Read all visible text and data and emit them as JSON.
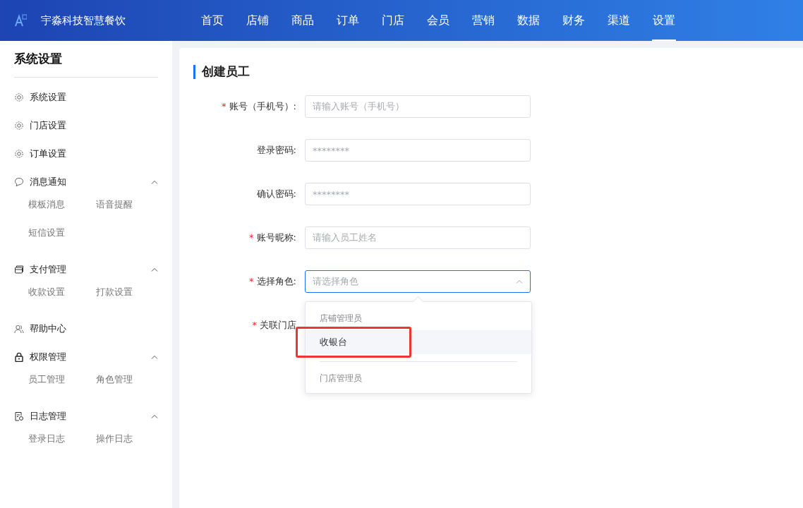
{
  "brand": {
    "name": "宇淼科技智慧餐饮"
  },
  "nav": [
    {
      "label": "首页",
      "selected": false
    },
    {
      "label": "店铺",
      "selected": false
    },
    {
      "label": "商品",
      "selected": false
    },
    {
      "label": "订单",
      "selected": false
    },
    {
      "label": "门店",
      "selected": false
    },
    {
      "label": "会员",
      "selected": false
    },
    {
      "label": "营销",
      "selected": false
    },
    {
      "label": "数据",
      "selected": false
    },
    {
      "label": "财务",
      "selected": false
    },
    {
      "label": "渠道",
      "selected": false
    },
    {
      "label": "设置",
      "selected": true
    }
  ],
  "sidebar": {
    "title": "系统设置",
    "items": [
      {
        "label": "系统设置"
      },
      {
        "label": "门店设置"
      },
      {
        "label": "订单设置"
      },
      {
        "label": "消息通知",
        "expanded": true,
        "children": [
          {
            "label": "模板消息"
          },
          {
            "label": "语音提醒"
          },
          {
            "label": "短信设置"
          }
        ]
      },
      {
        "label": "支付管理",
        "expanded": true,
        "children": [
          {
            "label": "收款设置"
          },
          {
            "label": "打款设置"
          }
        ]
      },
      {
        "label": "帮助中心"
      },
      {
        "label": "权限管理",
        "expanded": true,
        "children": [
          {
            "label": "员工管理"
          },
          {
            "label": "角色管理"
          }
        ]
      },
      {
        "label": "日志管理",
        "expanded": true,
        "children": [
          {
            "label": "登录日志"
          },
          {
            "label": "操作日志"
          }
        ]
      }
    ]
  },
  "form": {
    "title": "创建员工",
    "fields": [
      {
        "label": "账号（手机号）:",
        "mark": "*",
        "kind": "input",
        "placeholder": "请输入账号（手机号）"
      },
      {
        "label": "登录密码:",
        "kind": "input",
        "placeholder": "********"
      },
      {
        "label": "确认密码:",
        "kind": "input",
        "placeholder": "********"
      },
      {
        "label": "账号昵称:",
        "mark": "*",
        "kind": "input",
        "placeholder": "请输入员工姓名"
      },
      {
        "label": "选择角色:",
        "mark": "*",
        "kind": "select",
        "placeholder": "请选择角色",
        "expanded": true
      },
      {
        "label": "关联门店",
        "mark": "*",
        "kind": "covered"
      }
    ]
  },
  "dropdown": {
    "options": [
      {
        "label": "店铺管理员",
        "kind": "muted",
        "hovered": false,
        "highlighted": false
      },
      {
        "label": "收银台",
        "kind": "option",
        "hovered": true,
        "highlighted": true
      },
      {
        "label": "门店管理员",
        "kind": "muted",
        "hovered": false,
        "highlighted": false
      }
    ]
  }
}
